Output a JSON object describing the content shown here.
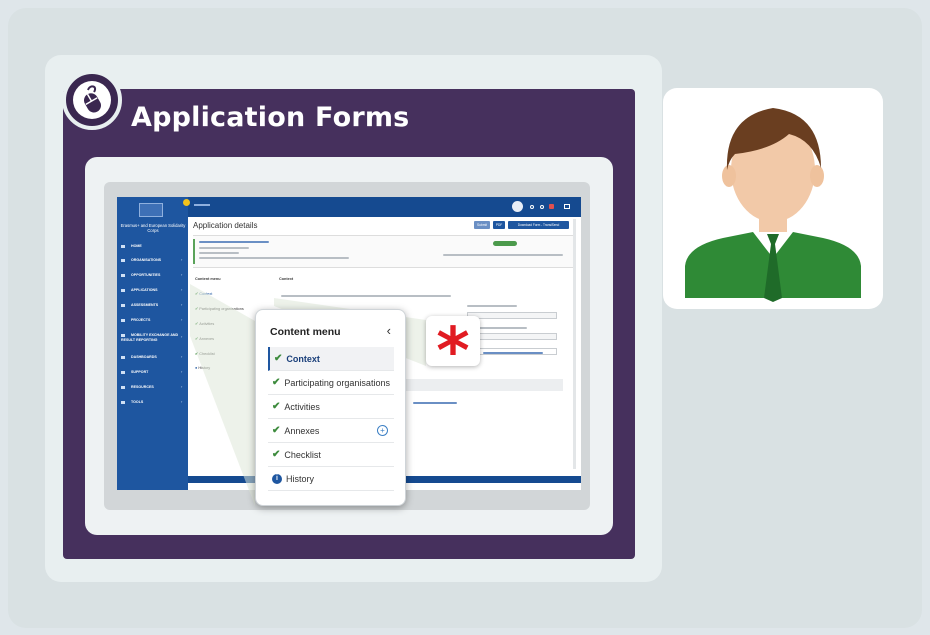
{
  "panel": {
    "title": "Application Forms"
  },
  "app": {
    "sidebar_title": "Erasmus+ and European Solidarity Corps",
    "sidebar_items": [
      "HOME",
      "ORGANISATIONS",
      "OPPORTUNITIES",
      "APPLICATIONS",
      "ASSESSMENTS",
      "PROJECTS",
      "MOBILITY EXCHANGE AND RESULT REPORTING",
      "DASHBOARDS",
      "SUPPORT",
      "RESOURCES",
      "TOOLS"
    ],
    "page_title": "Application details",
    "top_buttons": [
      "Submit",
      "PDF",
      "Download Form - TransiSend"
    ],
    "menu_heading": "Content menu",
    "context_heading": "Context",
    "menu_items": [
      "Context",
      "Participating organisations",
      "Activities",
      "Annexes",
      "Checklist",
      "History"
    ]
  },
  "popup": {
    "title": "Content menu",
    "close_icon": "chevron-left-icon",
    "items": [
      {
        "label": "Context",
        "icon": "check-icon",
        "active": true
      },
      {
        "label": "Participating organisations",
        "icon": "check-icon",
        "active": false
      },
      {
        "label": "Activities",
        "icon": "check-icon",
        "active": false
      },
      {
        "label": "Annexes",
        "icon": "check-icon",
        "active": false,
        "badge": "plus-circle-icon"
      },
      {
        "label": "Checklist",
        "icon": "check-icon",
        "active": false
      },
      {
        "label": "History",
        "icon": "info-icon",
        "active": false
      }
    ]
  },
  "required_marker": "*",
  "colors": {
    "panel": "#46305d",
    "app_blue": "#1e56a0",
    "check_green": "#3d8b3d",
    "asterisk_red": "#e11b22",
    "shirt_green": "#2f8a36"
  }
}
